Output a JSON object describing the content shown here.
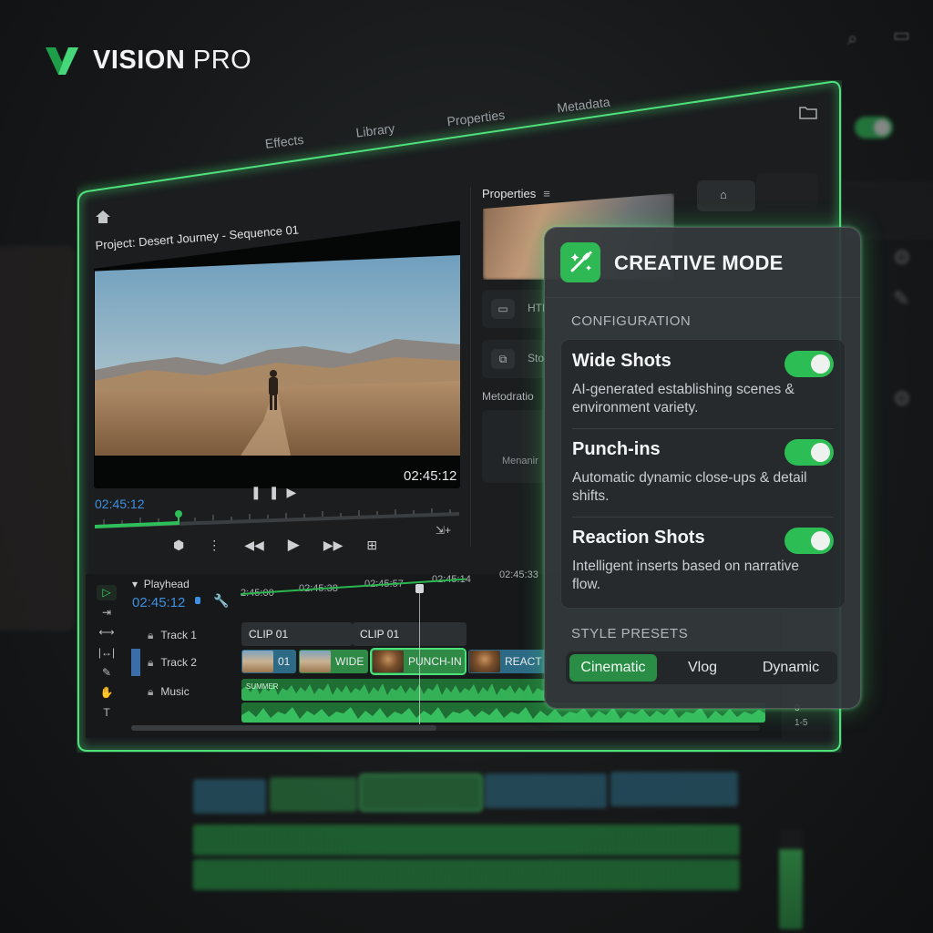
{
  "brand": {
    "name_bold": "VISION",
    "name_light": "PRO",
    "accent": "#2fb955"
  },
  "editor": {
    "tabs": [
      "Effects",
      "Library",
      "Properties",
      "Metadata"
    ],
    "project_title": "Project: Desert Journey - Sequence 01",
    "viewer": {
      "timecode_current": "02:45:12",
      "timecode_total": "02:45:12"
    },
    "properties": {
      "label": "Properties",
      "rows": [
        {
          "icon": "video-camera-icon",
          "label": "HTI"
        },
        {
          "icon": "copy-icon",
          "label": "Sto"
        }
      ],
      "metadata_label": "Metodratio",
      "metadata_item": "Menanir"
    },
    "timeline": {
      "playhead_label": "Playhead",
      "playhead_timecode": "02:45:12",
      "ruler": [
        "2:45:00",
        "02:45:38",
        "02:45:57",
        "02:45:14",
        "02:45:33"
      ],
      "tracks": [
        {
          "name": "Track 1",
          "clips": [
            "CLIP 01",
            "CLIP 01"
          ]
        },
        {
          "name": "Track 2",
          "clips": [
            "01",
            "WIDE",
            "PUNCH-IN",
            "REACT"
          ]
        },
        {
          "name": "Music",
          "clips": [
            "SUMMER"
          ]
        }
      ],
      "meter_values": [
        "0",
        "1-5"
      ]
    }
  },
  "creative_mode": {
    "title": "CREATIVE MODE",
    "configuration_label": "CONFIGURATION",
    "options": [
      {
        "title": "Wide Shots",
        "description": "AI-generated establishing scenes & environment variety.",
        "enabled": true
      },
      {
        "title": "Punch-ins",
        "description": "Automatic dynamic close-ups & detail shifts.",
        "enabled": true
      },
      {
        "title": "Reaction Shots",
        "description": "Intelligent inserts based on narrative flow.",
        "enabled": true
      }
    ],
    "style_presets_label": "STYLE PRESETS",
    "presets": [
      "Cinematic",
      "Vlog",
      "Dynamic"
    ],
    "active_preset": "Cinematic"
  }
}
